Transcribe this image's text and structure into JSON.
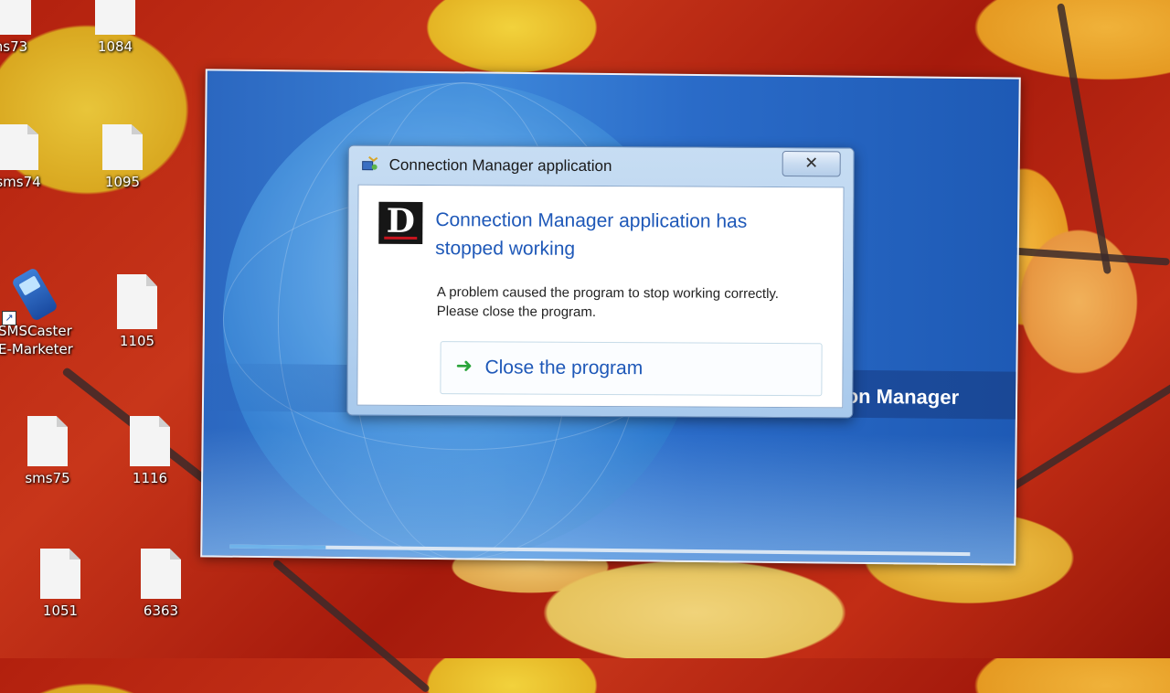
{
  "desktop": {
    "icons": [
      {
        "label": "ns73"
      },
      {
        "label": "1084"
      },
      {
        "label": "sms74"
      },
      {
        "label": "1095"
      },
      {
        "label": "SMSCaster\nE-Marketer"
      },
      {
        "label": "1105"
      },
      {
        "label": "sms75"
      },
      {
        "label": "1116"
      },
      {
        "label": "1051"
      },
      {
        "label": "6363"
      }
    ]
  },
  "splash": {
    "title_visible": "on Manager",
    "progress_percent": 13
  },
  "dialog": {
    "title": "Connection Manager application",
    "close_glyph": "✕",
    "headline": "Connection Manager application has stopped working",
    "message": "A problem caused the program to stop working correctly. Please close the program.",
    "command": {
      "icon": "green-arrow-icon",
      "label": "Close the program"
    },
    "logo_letter": "D"
  },
  "colors": {
    "headline_blue": "#1e58b8",
    "arrow_green": "#2aa43a"
  }
}
